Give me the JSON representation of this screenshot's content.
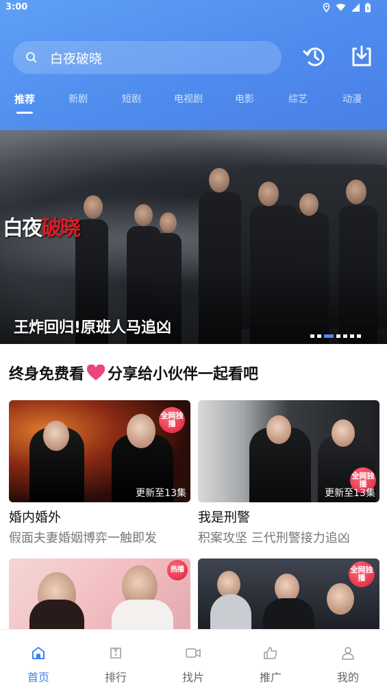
{
  "status_bar": {
    "time": "3:00",
    "icons": [
      "location-icon",
      "wifi-icon",
      "signal-icon",
      "battery-icon"
    ]
  },
  "search": {
    "value": "白夜破晓",
    "icon": "search-icon"
  },
  "header_actions": {
    "history_icon": "history-icon",
    "download_icon": "download-icon"
  },
  "tabs": [
    {
      "label": "推荐",
      "active": true
    },
    {
      "label": "新剧",
      "active": false
    },
    {
      "label": "短剧",
      "active": false
    },
    {
      "label": "电视剧",
      "active": false
    },
    {
      "label": "电影",
      "active": false
    },
    {
      "label": "综艺",
      "active": false
    },
    {
      "label": "动漫",
      "active": false
    }
  ],
  "banner": {
    "logo_text_white": "白夜",
    "logo_text_red": "破晓",
    "caption": "王炸回归!原班人马追凶",
    "slide_count": 7,
    "active_slide": 3
  },
  "section": {
    "title_left": "终身免费看",
    "title_right": "分享给小伙伴一起看吧",
    "heart_icon": "heart-icon"
  },
  "cards": [
    {
      "title": "婚内婚外",
      "desc": "假面夫妻婚姻博弈一触即发",
      "badge": "更新至13集",
      "tag": "全网独播"
    },
    {
      "title": "我是刑警",
      "desc": "积案攻坚 三代刑警接力追凶",
      "badge": "更新至13集",
      "tag": "全网独播"
    },
    {
      "title": "",
      "desc": "",
      "badge": "",
      "tag": "热播"
    },
    {
      "title": "",
      "desc": "",
      "badge": "",
      "tag": "全网独播"
    }
  ],
  "bottom_nav": [
    {
      "label": "首页",
      "icon": "home-icon",
      "active": true
    },
    {
      "label": "排行",
      "icon": "ranking-icon",
      "active": false
    },
    {
      "label": "找片",
      "icon": "video-icon",
      "active": false
    },
    {
      "label": "推广",
      "icon": "thumbs-up-icon",
      "active": false
    },
    {
      "label": "我的",
      "icon": "user-icon",
      "active": false
    }
  ],
  "colors": {
    "header": "#4f8cee",
    "accent": "#3d83ef",
    "heart": "#e8467c",
    "tag": "#d81e3a"
  }
}
